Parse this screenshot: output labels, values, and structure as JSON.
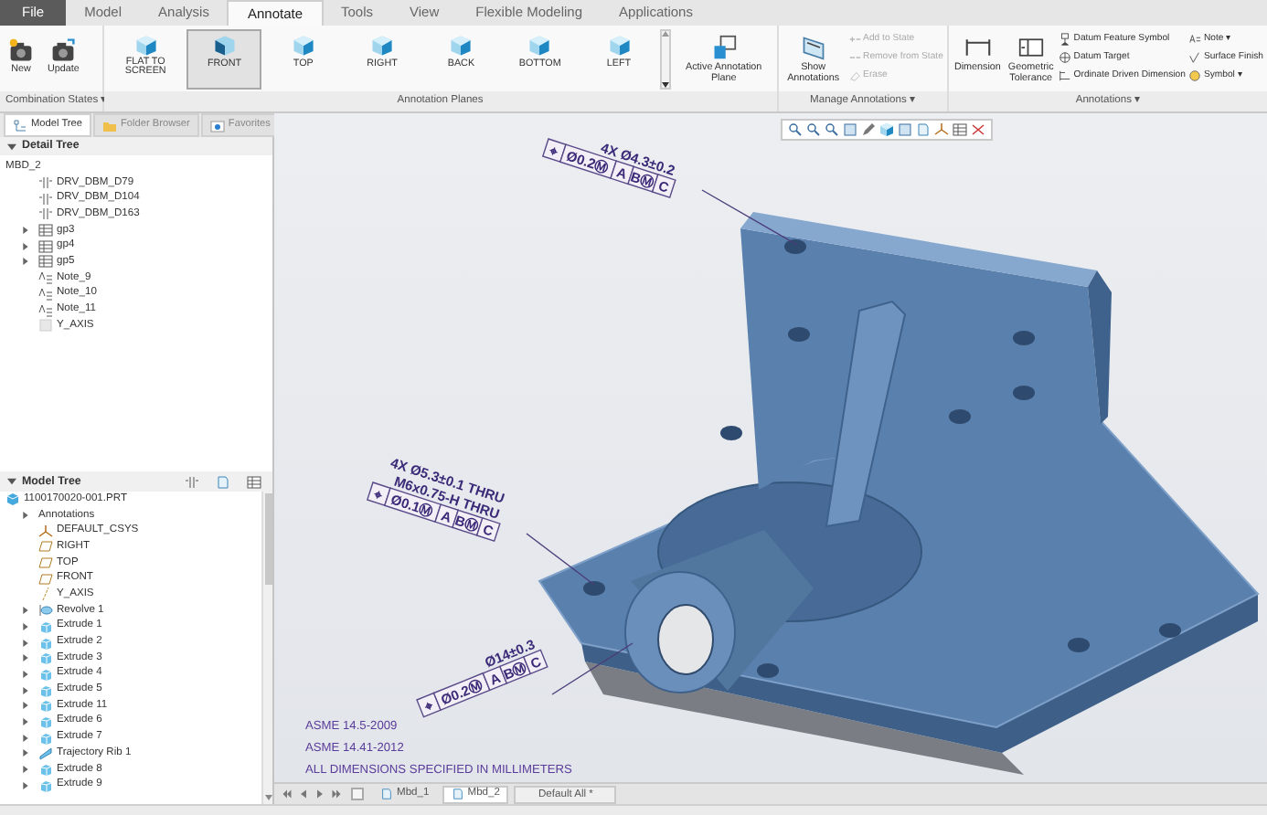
{
  "ribbon_tabs": [
    {
      "label": "File",
      "kind": "file",
      "selected": false
    },
    {
      "label": "Model",
      "kind": "tab",
      "selected": false
    },
    {
      "label": "Analysis",
      "kind": "tab",
      "selected": false
    },
    {
      "label": "Annotate",
      "kind": "tab",
      "selected": true
    },
    {
      "label": "Tools",
      "kind": "tab",
      "selected": false
    },
    {
      "label": "View",
      "kind": "tab",
      "selected": false
    },
    {
      "label": "Flexible Modeling",
      "kind": "tab",
      "selected": false
    },
    {
      "label": "Applications",
      "kind": "tab",
      "selected": false
    }
  ],
  "combination_states": {
    "buttons": [
      {
        "label": "New",
        "kind": "new"
      },
      {
        "label": "Update",
        "kind": "update"
      }
    ],
    "group_label": "Combination States ▾"
  },
  "annotation_planes": {
    "planes": [
      {
        "label": "FLAT TO SCREEN",
        "selected": false
      },
      {
        "label": "FRONT",
        "selected": true
      },
      {
        "label": "TOP",
        "selected": false
      },
      {
        "label": "RIGHT",
        "selected": false
      },
      {
        "label": "BACK",
        "selected": false
      },
      {
        "label": "BOTTOM",
        "selected": false
      },
      {
        "label": "LEFT",
        "selected": false
      }
    ],
    "active_plane_button": "Active Annotation Plane",
    "group_label": "Annotation Planes"
  },
  "manage_annotations": {
    "show_button": "Show Annotations",
    "actions": [
      {
        "label": "Add to State",
        "kind": "add",
        "disabled": true
      },
      {
        "label": "Remove from State",
        "kind": "remove",
        "disabled": true
      },
      {
        "label": "Erase",
        "kind": "erase",
        "disabled": true
      }
    ],
    "group_label": "Manage Annotations ▾"
  },
  "annotations": {
    "large_buttons": [
      {
        "label": "Dimension",
        "kind": "dimension"
      },
      {
        "label": "Geometric Tolerance",
        "kind": "tolerance"
      }
    ],
    "column_1": [
      {
        "label": "Datum Feature Symbol",
        "kind": "datum"
      },
      {
        "label": "Datum Target",
        "kind": "target"
      },
      {
        "label": "Ordinate Driven Dimension",
        "kind": "ordinate"
      }
    ],
    "column_2": [
      {
        "label": "Note ▾",
        "kind": "note"
      },
      {
        "label": "Surface Finish",
        "kind": "finish"
      },
      {
        "label": "Symbol ▾",
        "kind": "symbol"
      }
    ],
    "group_label": "Annotations ▾"
  },
  "panel_tabs": [
    {
      "label": "Model Tree",
      "kind": "model",
      "selected": true
    },
    {
      "label": "Folder Browser",
      "kind": "folder",
      "selected": false
    },
    {
      "label": "Favorites",
      "kind": "favorites",
      "selected": false
    }
  ],
  "detail_tree": {
    "title": "Detail Tree",
    "expanded": true,
    "items": [
      {
        "label": "MBD_2",
        "children": [
          {
            "label": "DRV_DBM_D79",
            "kind": "dimension"
          },
          {
            "label": "DRV_DBM_D104",
            "kind": "dimension"
          },
          {
            "label": "DRV_DBM_D163",
            "kind": "dimension"
          },
          {
            "label": "gp3",
            "kind": "group",
            "expanded": false
          },
          {
            "label": "gp4",
            "kind": "group",
            "expanded": false
          },
          {
            "label": "gp5",
            "kind": "group",
            "expanded": false
          },
          {
            "label": "Note_9",
            "kind": "note"
          },
          {
            "label": "Note_10",
            "kind": "note"
          },
          {
            "label": "Note_11",
            "kind": "note"
          },
          {
            "label": "Y_AXIS",
            "kind": "axis-ghost"
          }
        ]
      }
    ]
  },
  "model_tree": {
    "title": "Model Tree",
    "expanded": true,
    "items": [
      {
        "label": "1100170020-001.PRT",
        "kind": "part",
        "children": [
          {
            "label": "Annotations",
            "kind": "none",
            "expanded": false
          },
          {
            "label": "DEFAULT_CSYS",
            "kind": "csys"
          },
          {
            "label": "RIGHT",
            "kind": "plane"
          },
          {
            "label": "TOP",
            "kind": "plane"
          },
          {
            "label": "FRONT",
            "kind": "plane"
          },
          {
            "label": "Y_AXIS",
            "kind": "axis"
          },
          {
            "label": "Revolve 1",
            "kind": "revolve",
            "expanded": false
          },
          {
            "label": "Extrude 1",
            "kind": "extrude",
            "expanded": false
          },
          {
            "label": "Extrude 2",
            "kind": "extrude",
            "expanded": false
          },
          {
            "label": "Extrude 3",
            "kind": "extrude",
            "expanded": false
          },
          {
            "label": "Extrude 4",
            "kind": "extrude",
            "expanded": false
          },
          {
            "label": "Extrude 5",
            "kind": "extrude",
            "expanded": false
          },
          {
            "label": "Extrude 11",
            "kind": "extrude",
            "expanded": false
          },
          {
            "label": "Extrude 6",
            "kind": "extrude",
            "expanded": false
          },
          {
            "label": "Extrude 7",
            "kind": "extrude",
            "expanded": false
          },
          {
            "label": "Trajectory Rib 1",
            "kind": "rib",
            "expanded": false
          },
          {
            "label": "Extrude 8",
            "kind": "extrude",
            "expanded": false
          },
          {
            "label": "Extrude 9",
            "kind": "extrude",
            "expanded": false
          }
        ]
      }
    ]
  },
  "callouts": [
    {
      "dimension": [
        "4X Ø4.3±0.2"
      ],
      "frame": [
        "⌖",
        "Ø0.2Ⓜ",
        "A",
        "BⓂ",
        "C"
      ]
    },
    {
      "dimension": [
        "4X Ø5.3±0.1 THRU",
        "M6x0.75-H THRU"
      ],
      "frame": [
        "⌖",
        "Ø0.1Ⓜ",
        "A",
        "BⓂ",
        "C"
      ]
    },
    {
      "dimension": [
        "Ø14±0.3"
      ],
      "frame": [
        "⌖",
        "Ø0.2Ⓜ",
        "A",
        "BⓂ",
        "C"
      ]
    }
  ],
  "notes": [
    "ASME 14.5-2009",
    "ASME 14.41-2012",
    "ALL DIMENSIONS SPECIFIED IN MILLIMETERS"
  ],
  "sheet_tabs": [
    {
      "label": "Mbd_1",
      "selected": false
    },
    {
      "label": "Mbd_2",
      "selected": true
    }
  ],
  "combination_state": "Default All *"
}
